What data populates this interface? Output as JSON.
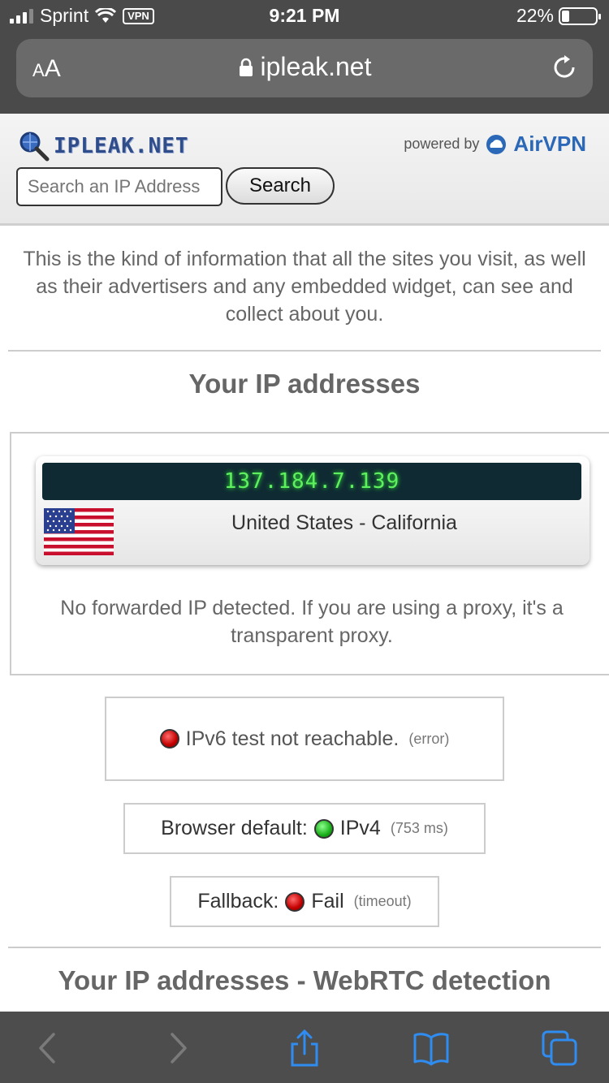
{
  "status_bar": {
    "carrier": "Sprint",
    "vpn_badge": "VPN",
    "time": "9:21 PM",
    "battery": "22%",
    "battery_level": 0.22
  },
  "browser": {
    "text_size_label": "AA",
    "url": "ipleak.net"
  },
  "site_header": {
    "logo_text": "IPLEAK.NET",
    "powered_by": "powered by",
    "brand": "AirVPN",
    "search_placeholder": "Search an IP Address",
    "search_button": "Search"
  },
  "intro": "This is the kind of information that all the sites you visit, as well as their advertisers and any embedded widget, can see and collect about you.",
  "ip_section": {
    "title": "Your IP addresses",
    "ip": "137.184.7.139",
    "location": "United States - California",
    "forwarded_note": "No forwarded IP detected. If you are using a proxy, it's a transparent proxy."
  },
  "ipv6_test": {
    "text": "IPv6 test not reachable.",
    "status": "(error)",
    "status_color": "#c40000"
  },
  "browser_default": {
    "label": "Browser default:",
    "value": "IPv4",
    "detail": "(753 ms)",
    "status_color": "#1ab01a"
  },
  "fallback": {
    "label": "Fallback:",
    "value": "Fail",
    "detail": "(timeout)",
    "status_color": "#c40000"
  },
  "webrtc_section": {
    "title": "Your IP addresses - WebRTC detection"
  },
  "toolbar": {
    "icons": [
      "back-icon",
      "forward-icon",
      "share-icon",
      "bookmarks-icon",
      "tabs-icon"
    ]
  }
}
